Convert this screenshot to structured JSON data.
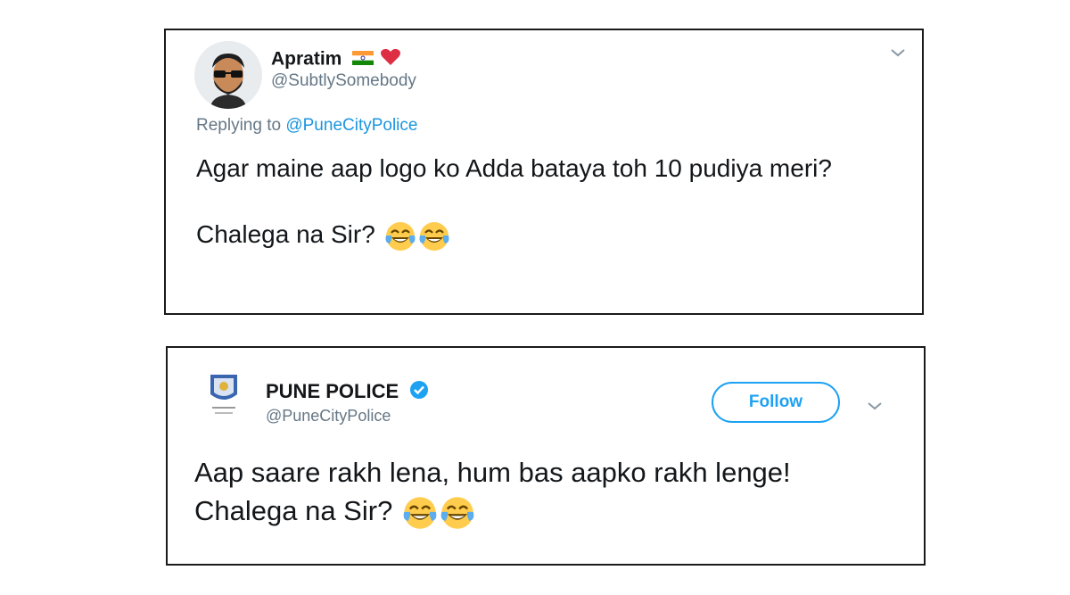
{
  "tweets": [
    {
      "name": "Apratim",
      "name_emojis": [
        "india-flag-icon",
        "red-heart-icon"
      ],
      "handle": "@SubtlySomebody",
      "replying_prefix": "Replying to ",
      "replying_to": "@PuneCityPolice",
      "text_line1": "Agar maine aap logo ko Adda bataya toh 10 pudiya meri?",
      "text_line2": "Chalega na Sir?",
      "emojis": [
        "tears-of-joy-emoji",
        "tears-of-joy-emoji"
      ]
    },
    {
      "name": "PUNE POLICE",
      "verified": true,
      "handle": "@PuneCityPolice",
      "follow_label": "Follow",
      "text": "Aap saare rakh lena, hum bas aapko rakh lenge! Chalega na Sir?",
      "emojis": [
        "tears-of-joy-emoji",
        "tears-of-joy-emoji"
      ]
    }
  ],
  "colors": {
    "link": "#1b95e0",
    "follow": "#1da1f2",
    "handle": "#657786",
    "text": "#14171a"
  }
}
